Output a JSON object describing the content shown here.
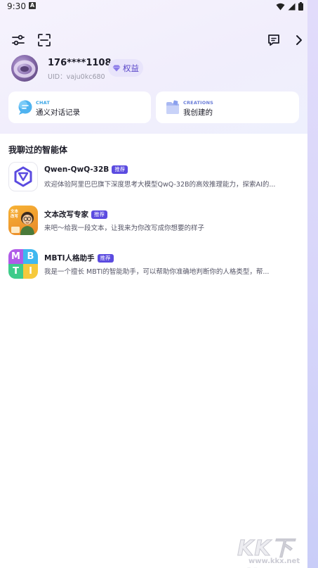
{
  "status_bar": {
    "time": "9:30",
    "notification_letter": "A"
  },
  "profile": {
    "username": "176****1108",
    "uid": "UID：vaju0kc680",
    "benefit_label": "权益"
  },
  "cards": {
    "chat": {
      "tag": "CHAT",
      "title": "通义对话记录"
    },
    "creations": {
      "tag": "CREATIONS",
      "title": "我创建的"
    }
  },
  "section": {
    "title": "我聊过的智能体"
  },
  "agents": [
    {
      "name": "Qwen-QwQ-32B",
      "badge": "推荐",
      "description": "欢迎体验阿里巴巴旗下深度思考大模型QwQ-32B的高效推理能力，探索AI的..."
    },
    {
      "name": "文本改写专家",
      "badge": "推荐",
      "description": "来吧～给我一段文本，让我来为你改写成你想要的样子",
      "avatar_text": "文本改写"
    },
    {
      "name": "MBTI人格助手",
      "badge": "推荐",
      "description": "我是一个擅长 MBTI的智能助手，可以帮助你准确地判断你的人格类型，帮...",
      "avatar_letters": [
        "M",
        "B",
        "T",
        "I"
      ]
    }
  ],
  "watermark": {
    "text": "KK下载",
    "url": "www.kkx.net"
  },
  "colors": {
    "accent": "#5b4be0",
    "benefit_bg": "#e8e4fb",
    "chat_tag": "#3aa6e6"
  }
}
